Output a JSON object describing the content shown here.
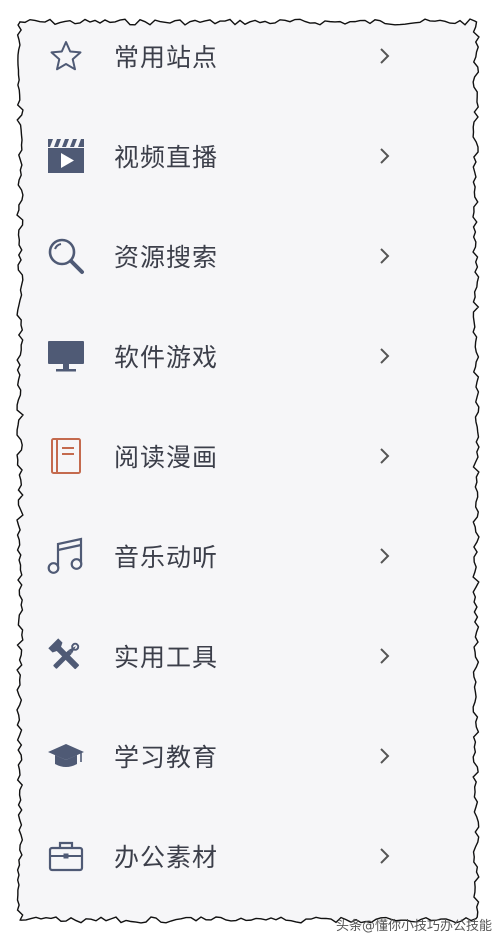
{
  "menu": {
    "items": [
      {
        "label": "常用站点",
        "icon": "star-icon"
      },
      {
        "label": "视频直播",
        "icon": "video-clapper-icon"
      },
      {
        "label": "资源搜索",
        "icon": "search-icon"
      },
      {
        "label": "软件游戏",
        "icon": "monitor-icon"
      },
      {
        "label": "阅读漫画",
        "icon": "book-icon"
      },
      {
        "label": "音乐动听",
        "icon": "music-note-icon"
      },
      {
        "label": "实用工具",
        "icon": "tools-icon"
      },
      {
        "label": "学习教育",
        "icon": "graduation-cap-icon"
      },
      {
        "label": "办公素材",
        "icon": "briefcase-icon"
      }
    ]
  },
  "watermark": "头条@懂你小技巧办公技能",
  "colors": {
    "panel": "#f6f6f8",
    "text": "#3c3f4a",
    "icon": "#4f5a75",
    "book_accent": "#c46a4e",
    "chevron": "#555555"
  }
}
